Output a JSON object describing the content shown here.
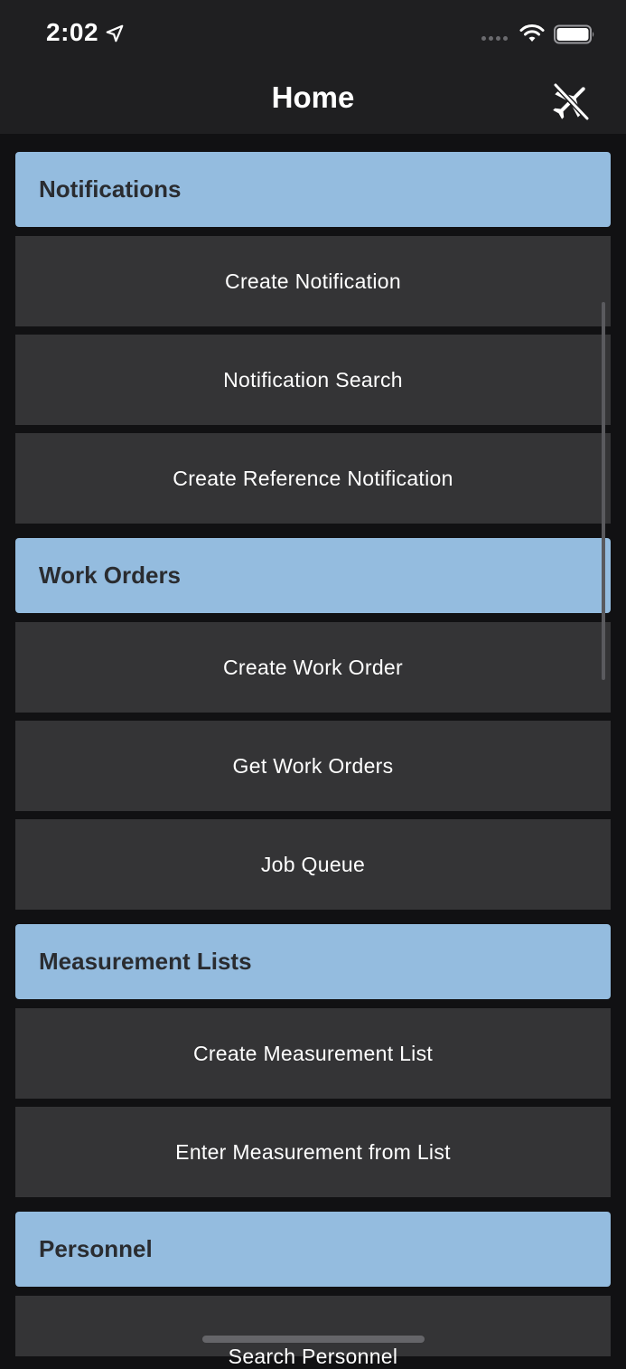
{
  "status": {
    "time": "2:02"
  },
  "nav": {
    "title": "Home",
    "offline_icon": "airplane-off-icon"
  },
  "sections": [
    {
      "title": "Notifications",
      "items": [
        "Create Notification",
        "Notification Search",
        "Create Reference Notification"
      ]
    },
    {
      "title": "Work Orders",
      "items": [
        "Create Work Order",
        "Get Work Orders",
        "Job Queue"
      ]
    },
    {
      "title": "Measurement Lists",
      "items": [
        "Create Measurement List",
        "Enter Measurement from List"
      ]
    },
    {
      "title": "Personnel",
      "items": [
        "Search Personnel"
      ]
    }
  ],
  "colors": {
    "section_header_bg": "#94bcdf",
    "menu_item_bg": "#343436",
    "background": "#111113",
    "bar_bg": "#1f1f21"
  }
}
